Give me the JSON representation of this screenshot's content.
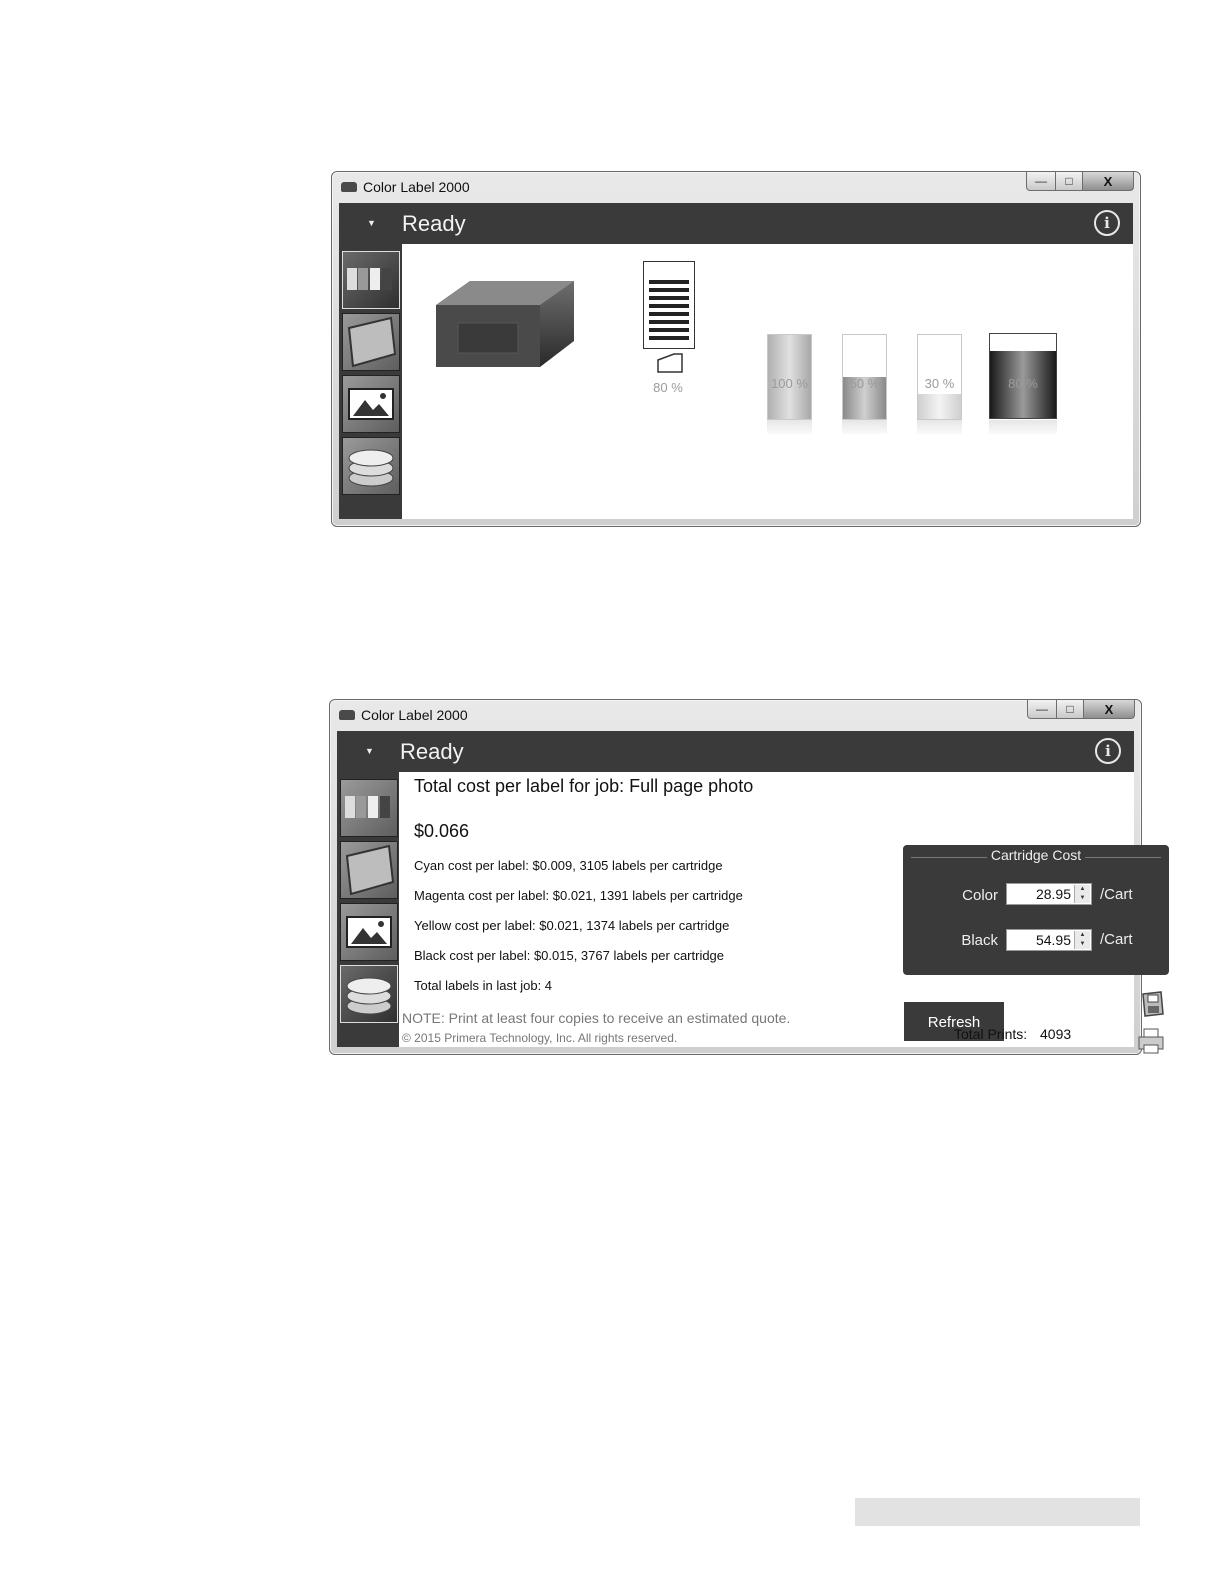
{
  "window1": {
    "title": "Color Label 2000",
    "status": "Ready",
    "label_level": "80 %",
    "ink": [
      {
        "label": "100 %",
        "level": 1.0
      },
      {
        "label": "50 %",
        "level": 0.5
      },
      {
        "label": "30 %",
        "level": 0.3
      },
      {
        "label": "80 %",
        "level": 0.8
      }
    ]
  },
  "window2": {
    "title": "Color Label 2000",
    "status": "Ready",
    "heading": "Total cost per label for job: Full page photo",
    "total_cost": "$0.066",
    "lines": [
      "Cyan cost per label: $0.009, 3105 labels per cartridge",
      "Magenta cost per label: $0.021, 1391 labels per cartridge",
      "Yellow cost per label: $0.021, 1374 labels per cartridge",
      "Black cost per label: $0.015, 3767 labels per cartridge",
      "Total labels in last job: 4"
    ],
    "note": "NOTE:  Print at least four copies to receive an estimated quote.",
    "copyright": "© 2015 Primera Technology, Inc. All rights reserved.",
    "cartridge_cost": {
      "title": "Cartridge Cost",
      "color_label": "Color",
      "color_value": "28.95",
      "black_label": "Black",
      "black_value": "54.95",
      "unit": "/Cart"
    },
    "refresh_label": "Refresh",
    "total_prints_label": "Total Prints:",
    "total_prints_value": "4093"
  },
  "window_controls": {
    "minimize": "▭",
    "maximize": "□",
    "close": "X"
  }
}
